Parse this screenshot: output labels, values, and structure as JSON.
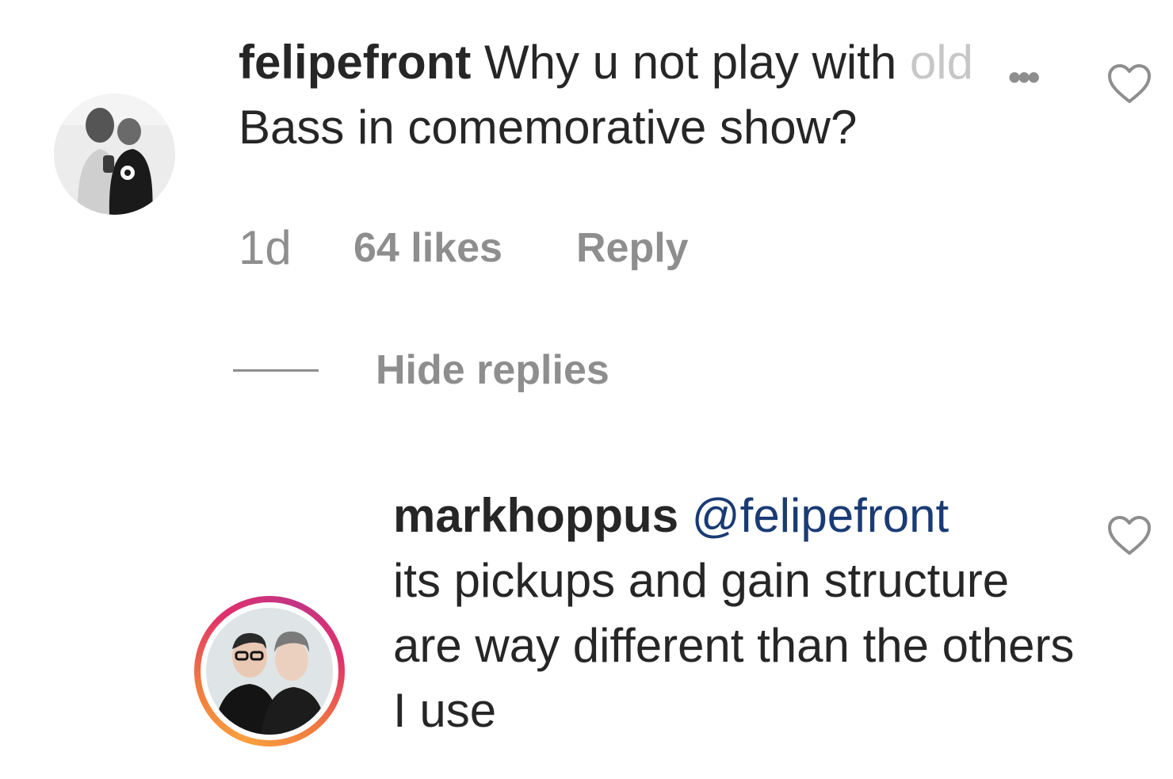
{
  "comment": {
    "username": "felipefront",
    "text_dark": "Why u not play with",
    "text_faded": "old",
    "text_line2": "Bass in comemorative show?",
    "more_icon": "more-dots-icon",
    "like_icon": "heart-icon",
    "time": "1d",
    "likes": "64 likes",
    "reply_label": "Reply"
  },
  "replies_toggle": {
    "label": "Hide replies"
  },
  "reply": {
    "username": "markhoppus",
    "mention": "@felipefront",
    "text": "its pickups and gain structure are way different than the others I use",
    "like_icon": "heart-icon",
    "avatar_ring_colors": [
      "#f9a03f",
      "#e1306c",
      "#c13584"
    ]
  }
}
